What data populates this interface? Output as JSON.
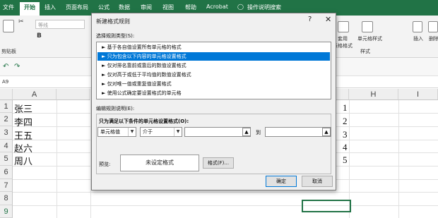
{
  "ribbon_tabs": [
    "文件",
    "开始",
    "插入",
    "页面布局",
    "公式",
    "数据",
    "审阅",
    "视图",
    "帮助",
    "Acrobat"
  ],
  "ribbon_search": "操作说明搜索",
  "ribbon": {
    "clipboard_label": "剪贴板",
    "font_name": "等线",
    "styles_label": "样式",
    "table_format": "套用\n表格格式",
    "cell_styles": "单元格样式",
    "insert": "插入",
    "delete": "删除"
  },
  "name_box": "A9",
  "columns": [
    "A",
    "H",
    "I"
  ],
  "rows": [
    "1",
    "2",
    "3",
    "4",
    "5",
    "6",
    "7",
    "8",
    "9"
  ],
  "cells_A": [
    "张三",
    "李四",
    "王五",
    "赵六",
    "周八"
  ],
  "cells_G": [
    "1",
    "2",
    "3",
    "4",
    "5"
  ],
  "dialog": {
    "title": "新建格式规则",
    "help": "?",
    "close": "✕",
    "select_type_label": "选择规则类型(S):",
    "rule_types": [
      "► 基于各自值设置所有单元格的格式",
      "► 只为包含以下内容的单元格设置格式",
      "► 仅对排名靠前或靠后的数值设置格式",
      "► 仅对高于或低于平均值的数值设置格式",
      "► 仅对唯一值或重复值设置格式",
      "► 使用公式确定要设置格式的单元格"
    ],
    "selected_index": 1,
    "edit_label": "编辑规则说明(E):",
    "format_only_label": "只为满足以下条件的单元格设置格式(O):",
    "combo1": "单元格值",
    "combo2": "介于",
    "to_label": "到",
    "preview_label": "预览:",
    "preview_text": "未设定格式",
    "format_button": "格式(F)...",
    "ok_button": "确定",
    "cancel_button": "取消"
  },
  "colors": {
    "excel_green": "#217346",
    "selection_blue": "#0078d7"
  }
}
